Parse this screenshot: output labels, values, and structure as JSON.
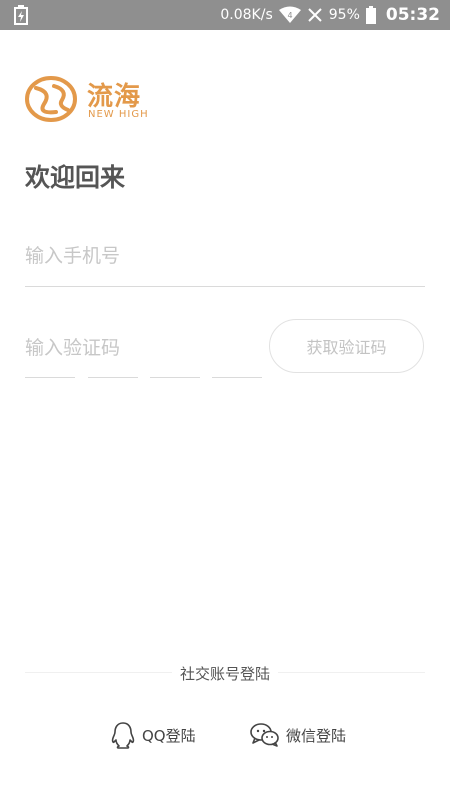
{
  "status_bar": {
    "speed": "0.08K/s",
    "battery": "95%",
    "time": "05:32",
    "icons": [
      "battery-charging-icon",
      "wifi-icon",
      "no-signal-icon",
      "battery-icon"
    ]
  },
  "logo": {
    "name": "流海",
    "subtitle": "NEW HIGH",
    "brand_color": "#e3994a"
  },
  "welcome": {
    "title": "欢迎回来"
  },
  "form": {
    "phone_placeholder": "输入手机号",
    "code_placeholder": "输入验证码",
    "get_code_label": "获取验证码"
  },
  "social": {
    "title": "社交账号登陆",
    "qq_label": "QQ登陆",
    "wechat_label": "微信登陆",
    "icons": [
      "qq-icon",
      "wechat-icon"
    ]
  }
}
